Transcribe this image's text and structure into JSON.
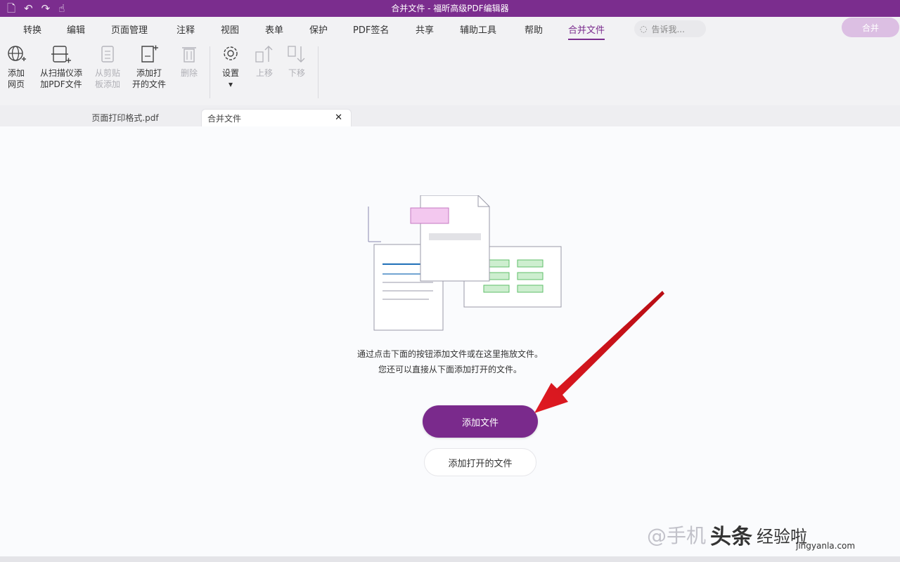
{
  "titlebar": {
    "title": "合并文件 - 福昕高级PDF编辑器",
    "quick_access": [
      "file-icon",
      "undo-icon",
      "redo-icon",
      "hand-icon"
    ]
  },
  "menu": {
    "items": [
      "转换",
      "编辑",
      "页面管理",
      "注释",
      "视图",
      "表单",
      "保护",
      "PDF签名",
      "共享",
      "辅助工具",
      "帮助",
      "合并文件"
    ],
    "active": "合并文件",
    "search_placeholder": "告诉我..."
  },
  "ribbon": {
    "buttons": [
      {
        "label_lines": [
          "添加",
          "网页"
        ],
        "icon": "globe-add-icon",
        "enabled": true
      },
      {
        "label_lines": [
          "从扫描仪添",
          "加PDF文件"
        ],
        "icon": "scanner-add-icon",
        "enabled": true
      },
      {
        "label_lines": [
          "从剪贴",
          "板添加"
        ],
        "icon": "clipboard-icon",
        "enabled": false
      },
      {
        "label_lines": [
          "添加打",
          "开的文件"
        ],
        "icon": "open-file-add-icon",
        "enabled": true
      },
      {
        "label_lines": [
          "删除"
        ],
        "icon": "trash-icon",
        "enabled": false
      },
      {
        "label_lines": [
          "设置"
        ],
        "icon": "gear-icon",
        "enabled": true
      },
      {
        "label_lines": [
          "上移"
        ],
        "icon": "move-up-icon",
        "enabled": false
      },
      {
        "label_lines": [
          "下移"
        ],
        "icon": "move-down-icon",
        "enabled": false
      }
    ],
    "merge_label": "合并"
  },
  "tabs": [
    {
      "label": "页面打印格式.pdf",
      "active": false
    },
    {
      "label": "合并文件",
      "active": true
    }
  ],
  "content": {
    "hint_line1": "通过点击下面的按钮添加文件或在这里拖放文件。",
    "hint_line2": "您还可以直接从下面添加打开的文件。",
    "add_files_label": "添加文件",
    "add_open_files_label": "添加打开的文件"
  },
  "watermark": {
    "text1": "@手机",
    "text2": "头条",
    "text3": "经验啦",
    "site": "jingyanla.com"
  },
  "colors": {
    "brand": "#7b2d8e",
    "arrow": "#d8141e"
  }
}
